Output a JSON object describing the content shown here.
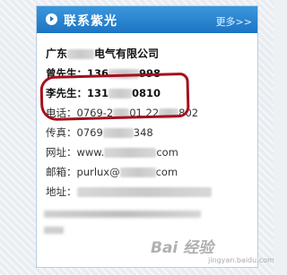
{
  "header": {
    "title": "联系紫光",
    "more_label": "更多>>"
  },
  "contact": {
    "company_prefix": "广东",
    "company_suffix": "电气有限公司",
    "person1": {
      "label": "曾先生：",
      "phone_start": "136",
      "phone_end": "998"
    },
    "person2": {
      "label": "李先生：",
      "phone_start": "131",
      "phone_end": "0810"
    },
    "phone": {
      "label": "电话：",
      "value_start": "0769-2",
      "value_mid": "01 22",
      "value_end": "802"
    },
    "fax": {
      "label": "传真：",
      "value_start": "0769",
      "value_end": "348"
    },
    "website": {
      "label": "网址：",
      "value_start": "www.",
      "value_end": "com"
    },
    "email": {
      "label": "邮箱：",
      "value_start": "purlux@",
      "value_end": "com"
    },
    "address": {
      "label": "地址："
    }
  },
  "watermark": {
    "text": "Bai 经验",
    "sub": "jingyan.baidu.com"
  },
  "colors": {
    "header_blue": "#1d74c3",
    "highlight_red": "#a4101c"
  }
}
